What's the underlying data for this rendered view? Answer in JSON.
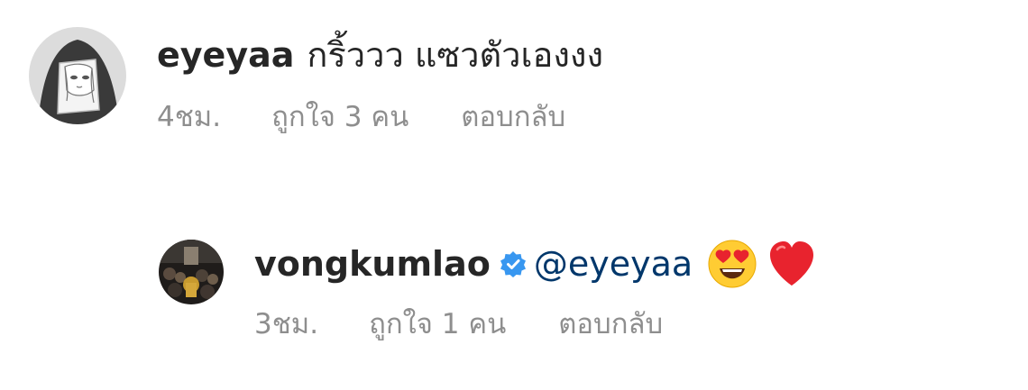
{
  "comments": [
    {
      "username": "eyeyaa",
      "text": "กริ้ววว แซวตัวเองงง",
      "avatar_icon": "sketch-avatar",
      "time": "4ชม.",
      "likes": "ถูกใจ 3 คน",
      "reply_label": "ตอบกลับ"
    },
    {
      "username": "vongkumlao",
      "verified_icon": "verified-badge-icon",
      "mention": "@eyeyaa",
      "emojis": [
        "heart-eyes-emoji",
        "red-heart-emoji"
      ],
      "avatar_icon": "crowd-photo-avatar",
      "time": "3ชม.",
      "likes": "ถูกใจ 1 คน",
      "reply_label": "ตอบกลับ"
    }
  ],
  "colors": {
    "text": "#262626",
    "meta": "#8e8e8e",
    "mention": "#00376b",
    "verified": "#3897f0"
  }
}
